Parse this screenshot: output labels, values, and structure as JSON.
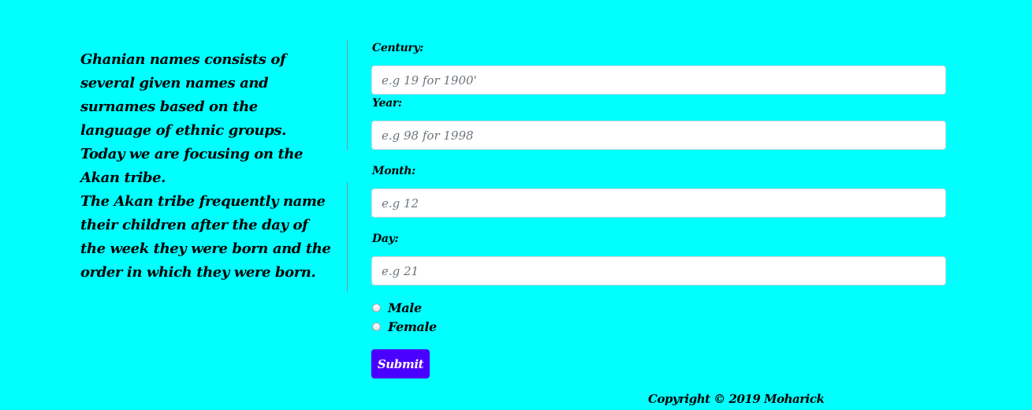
{
  "intro": {
    "paragraph_1": "Ghanian names consists of several given names and surnames based on the language of ethnic groups. Today we are focusing on the Akan tribe.",
    "paragraph_2": "The Akan tribe frequently name their children after the day of the week they were born and the order in which they were born."
  },
  "form": {
    "century": {
      "label": "Century:",
      "placeholder": "e.g 19 for 1900'",
      "value": ""
    },
    "year": {
      "label": "Year:",
      "placeholder": "e.g 98 for 1998",
      "value": ""
    },
    "month": {
      "label": "Month:",
      "placeholder": "e.g 12",
      "value": ""
    },
    "day": {
      "label": "Day:",
      "placeholder": "e.g 21",
      "value": ""
    },
    "gender": {
      "options": [
        "Male",
        "Female"
      ],
      "selected": null
    },
    "submit_label": "Submit"
  },
  "footer": {
    "copyright": "Copyright © 2019 Moharick"
  },
  "colors": {
    "background": "#00ffff",
    "submit_button": "#4b00ff",
    "divider": "#6b9ea0"
  }
}
